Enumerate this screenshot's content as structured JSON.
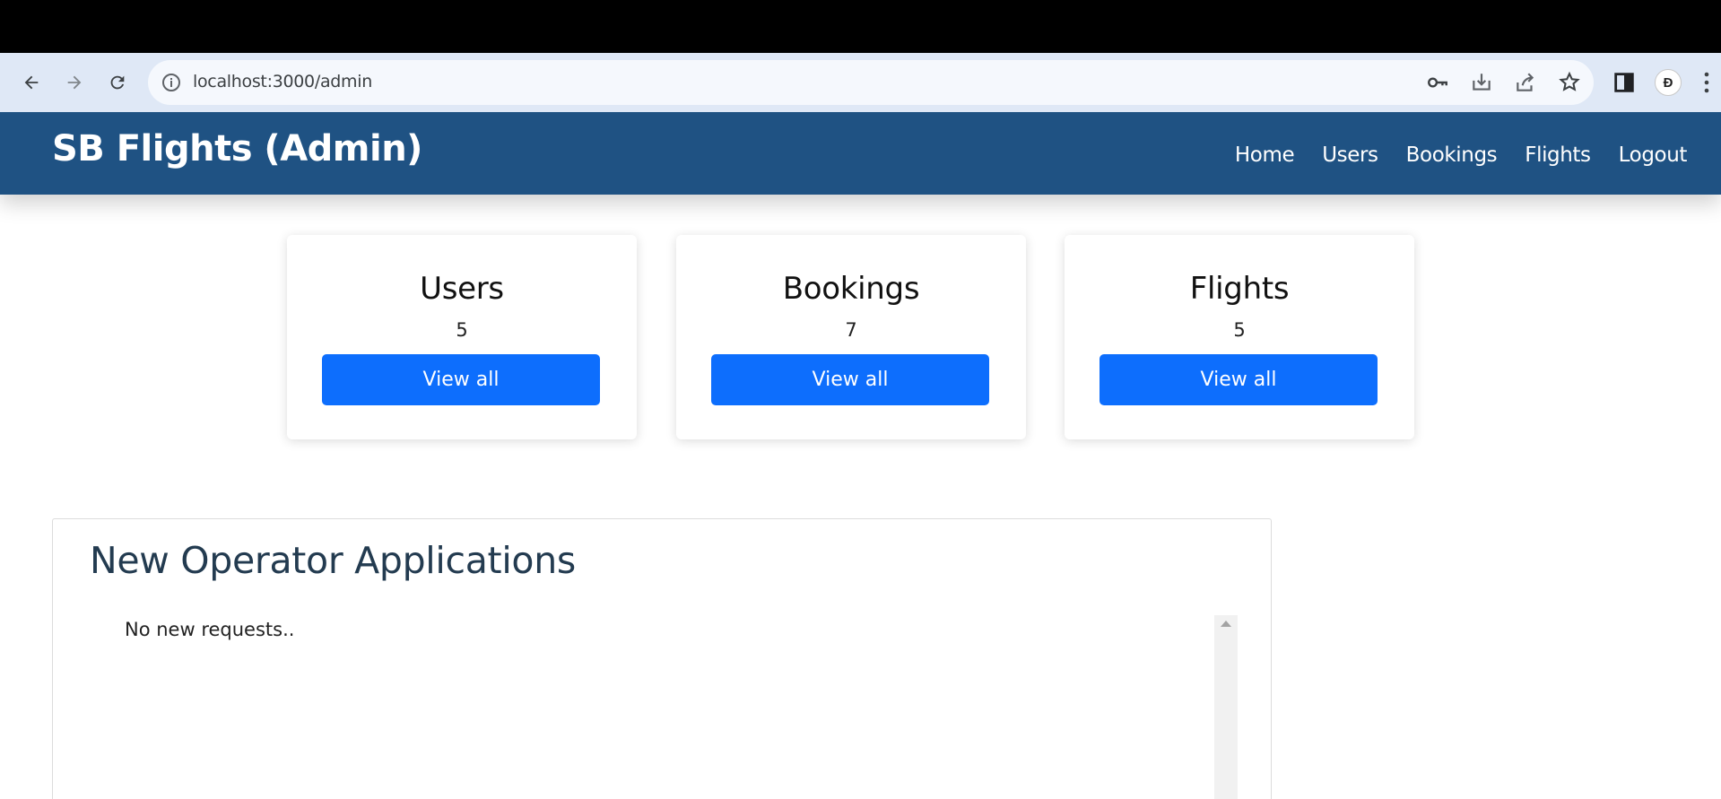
{
  "browser": {
    "url": "localhost:3000/admin",
    "icons": [
      "back-arrow-icon",
      "forward-arrow-icon",
      "reload-icon",
      "site-info-icon",
      "key-icon",
      "install-icon",
      "share-icon",
      "bookmark-star-icon",
      "side-panel-icon",
      "profile-avatar",
      "menu-kebab-icon"
    ],
    "profile_initial": "Đ"
  },
  "navbar": {
    "brand": "SB Flights (Admin)",
    "links": [
      "Home",
      "Users",
      "Bookings",
      "Flights",
      "Logout"
    ],
    "bg_color": "#1f5283"
  },
  "cards": [
    {
      "title": "Users",
      "count": "5",
      "button": "View all"
    },
    {
      "title": "Bookings",
      "count": "7",
      "button": "View all"
    },
    {
      "title": "Flights",
      "count": "5",
      "button": "View all"
    }
  ],
  "applications": {
    "heading": "New Operator Applications",
    "empty_text": "No new requests.."
  },
  "colors": {
    "primary_button": "#0d6efd",
    "heading": "#233b50"
  }
}
